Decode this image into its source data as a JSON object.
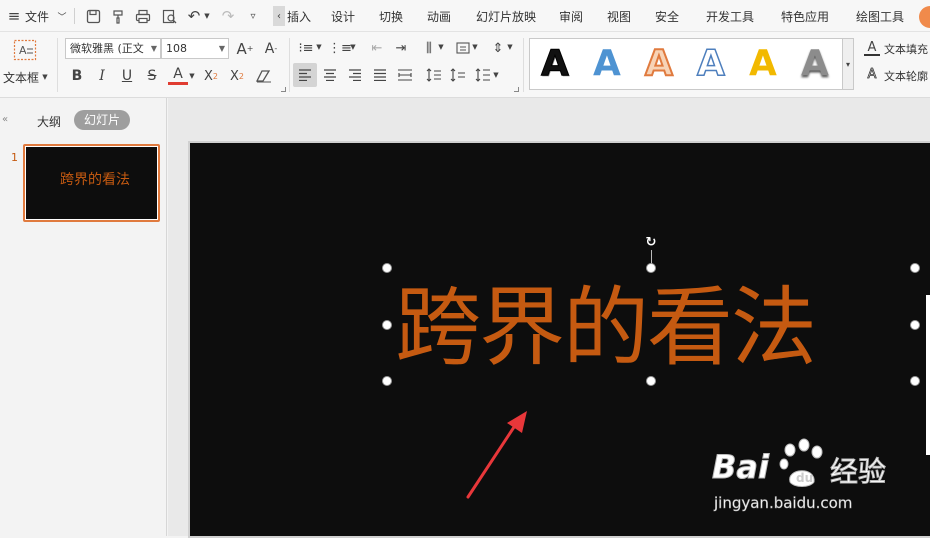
{
  "menu": {
    "file_label": "文件",
    "tabs": [
      "插入",
      "设计",
      "切换",
      "动画",
      "幻灯片放映",
      "审阅",
      "视图",
      "安全",
      "开发工具",
      "特色应用",
      "绘图工具"
    ]
  },
  "ribbon": {
    "textbox_label": "文本框",
    "font_name": "微软雅黑 (正文",
    "font_size": "108",
    "wordart_letter": "A",
    "text_fill_label": "文本填充",
    "text_outline_label": "文本轮廓"
  },
  "left_panel": {
    "tab_outline": "大纲",
    "tab_slides": "幻灯片",
    "slide_number": "1",
    "thumbnail_title": "跨界的看法"
  },
  "slide": {
    "title": "跨界的看法",
    "title_color": "#c55a11",
    "background_color": "#0d0d0d"
  },
  "watermark": {
    "brand": "Bai",
    "brand_suffix": "经验",
    "url": "jingyan.baidu.com"
  }
}
